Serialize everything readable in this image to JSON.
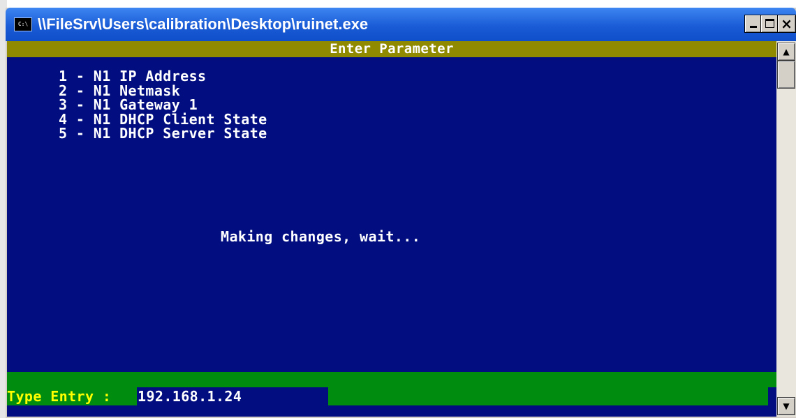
{
  "window": {
    "title": "\\\\FileSrv\\Users\\calibration\\Desktop\\ruinet.exe",
    "icon": "console-app-icon",
    "icon_label": "C:\\",
    "controls": {
      "close_glyph": "×"
    }
  },
  "console": {
    "header": "Enter Parameter",
    "menu_items": [
      {
        "label": "1 - N1 IP Address"
      },
      {
        "label": "2 - N1 Netmask"
      },
      {
        "label": "3 - N1 Gateway 1"
      },
      {
        "label": "4 - N1 DHCP Client State"
      },
      {
        "label": "5 - N1 DHCP Server State"
      }
    ],
    "status": "Making changes, wait...",
    "entry": {
      "label": "Type Entry :",
      "value": "192.168.1.24"
    }
  },
  "scrollbar": {
    "up_glyph": "▲",
    "down_glyph": "▼"
  },
  "colors": {
    "console_bg": "#020d80",
    "header_bar": "#8f8a00",
    "status_bar": "#008c0e",
    "entry_label_text": "#ffff00",
    "text": "#ffffff"
  }
}
